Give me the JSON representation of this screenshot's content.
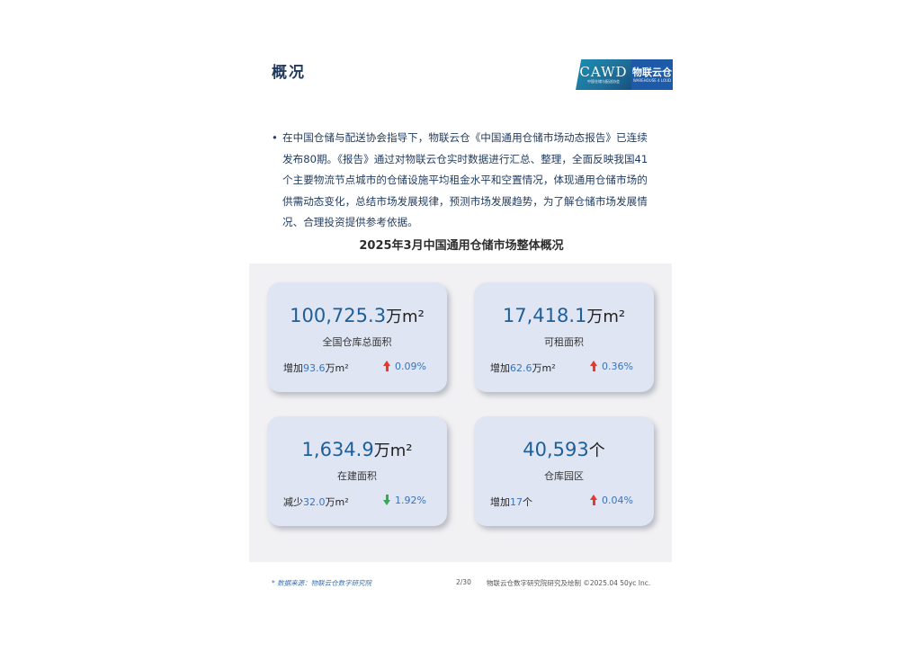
{
  "header": {
    "title": "概况",
    "logo": {
      "cawd_text": "CAWD",
      "cawd_subtext": "中国仓储与配送协会",
      "wl_text": "物联云仓",
      "wl_subtext": "WAREHOUSE 4 LOUD"
    }
  },
  "intro": {
    "bullet": "•",
    "text": "在中国仓储与配送协会指导下，物联云仓《中国通用仓储市场动态报告》已连续发布80期。《报告》通过对物联云仓实时数据进行汇总、整理，全面反映我国41个主要物流节点城市的仓储设施平均租金水平和空置情况，体现通用仓储市场的供需动态变化，总结市场发展规律，预测市场发展趋势，为了解仓储市场发展情况、合理投资提供参考依据。"
  },
  "section_title": "2025年3月中国通用仓储市场整体概况",
  "cards": [
    {
      "value": "100,725.3",
      "unit": "万m²",
      "label": "全国仓库总面积",
      "change_prefix": "增加",
      "change_value": "93.6",
      "change_unit": "万m²",
      "direction": "up",
      "percent": "0.09%"
    },
    {
      "value": "17,418.1",
      "unit": "万m²",
      "label": "可租面积",
      "change_prefix": "增加",
      "change_value": "62.6",
      "change_unit": "万m²",
      "direction": "up",
      "percent": "0.36%"
    },
    {
      "value": "1,634.9",
      "unit": "万m²",
      "label": "在建面积",
      "change_prefix": "减少",
      "change_value": "32.0",
      "change_unit": "万m²",
      "direction": "down",
      "percent": "1.92%"
    },
    {
      "value": "40,593",
      "unit": "个",
      "label": "仓库园区",
      "change_prefix": "增加",
      "change_value": "17",
      "change_unit": "个",
      "direction": "up",
      "percent": "0.04%"
    }
  ],
  "footer": {
    "source": "* 数据来源：物联云仓数字研究院",
    "page": "2/30",
    "org": "物联云仓数字研究院研究及绘制  ©2025.04 50yc Inc."
  },
  "colors": {
    "title": "#1f3a5f",
    "value": "#1f5f99",
    "up": "#e23a2e",
    "down": "#3aa65a",
    "card_bg": "#dfe5f2",
    "panel_bg": "#f1f1f3"
  }
}
